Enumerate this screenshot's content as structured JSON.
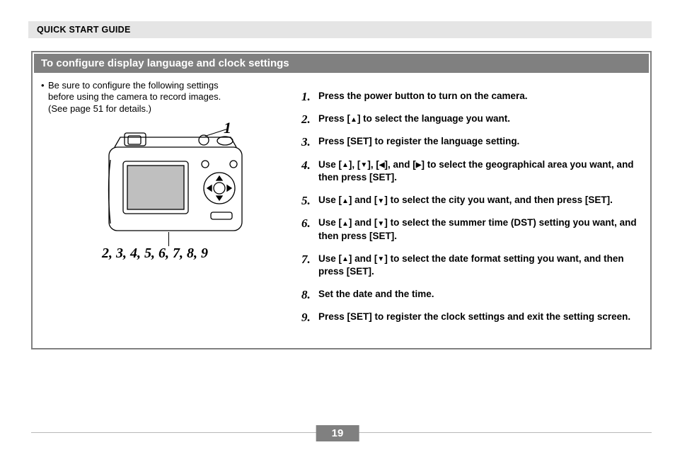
{
  "header": "QUICK START GUIDE",
  "section_title": "To configure display language and clock settings",
  "note": {
    "line1": "Be sure to configure the following settings",
    "line2": "before using the camera to record images.",
    "line3": "(See page 51 for details.)"
  },
  "callout_top": "1",
  "callout_bottom": "2, 3, 4, 5, 6, 7, 8, 9",
  "steps": [
    {
      "n": "1.",
      "html": "Press the power button to turn on the camera."
    },
    {
      "n": "2.",
      "html": "Press [▲] to select the language you want."
    },
    {
      "n": "3.",
      "html": "Press [SET] to register the language setting."
    },
    {
      "n": "4.",
      "html": "Use [▲], [▼], [◀], and [▶] to select the geographical area you want, and then press [SET]."
    },
    {
      "n": "5.",
      "html": "Use [▲] and [▼] to select the city you want, and then press [SET]."
    },
    {
      "n": "6.",
      "html": "Use [▲] and [▼] to select the summer time (DST) setting you want, and then press [SET]."
    },
    {
      "n": "7.",
      "html": "Use [▲] and [▼] to select the date format setting you want, and then press [SET]."
    },
    {
      "n": "8.",
      "html": "Set the date and the time."
    },
    {
      "n": "9.",
      "html": "Press [SET] to register the clock settings and exit the setting screen."
    }
  ],
  "page_number": "19"
}
